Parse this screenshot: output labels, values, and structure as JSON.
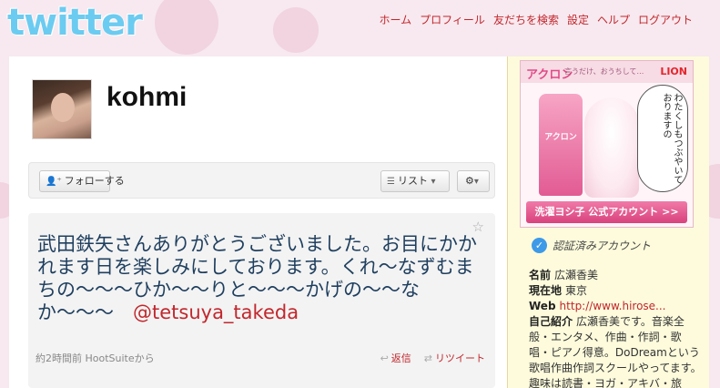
{
  "logo": "twitter",
  "nav": {
    "items": [
      "ホーム",
      "プロフィール",
      "友だちを検索",
      "設定",
      "ヘルプ",
      "ログアウト"
    ]
  },
  "profile": {
    "username": "kohmi",
    "follow_label": "フォローする",
    "list_label": "リスト",
    "gear_label": "⚙"
  },
  "tweet": {
    "text": "武田鉄矢さんありがとうございました。お目にかかれます日を楽しみにしております。くれ〜なずむまちの〜〜〜ひか〜〜りと〜〜〜かげの〜〜なか〜〜〜　",
    "mention": "@tetsuya_takeda",
    "meta": "約2時間前 HootSuiteから",
    "reply": "返信",
    "retweet": "リツイート"
  },
  "ad": {
    "brand": "アクロン",
    "tagline": "言うだけ、おうちして…",
    "maker": "LION",
    "bottle_label": "アクロン",
    "bubble": "わたくしもつぶやいておりますの",
    "cta": "洗濯ヨシ子 公式アカウント >>"
  },
  "sidebar": {
    "verified": "認証済みアカウント",
    "name_label": "名前",
    "name": "広瀬香美",
    "location_label": "現在地",
    "location": "東京",
    "web_label": "Web",
    "web": "http://www.hirose...",
    "bio_label": "自己紹介",
    "bio": "広瀬香美です。音楽全般・エンタメ、作曲・作詞・歌唱・ピアノ得意。DoDreamという歌唱作曲作詞スクールやってます。趣味は読書・ヨガ・アキバ・旅行。私は「音"
  },
  "colors": {
    "link": "#c1272d",
    "logo": "#6ccbf0",
    "tweet_text": "#1f3f5f",
    "sidebar_bg": "#fdfbdc"
  }
}
